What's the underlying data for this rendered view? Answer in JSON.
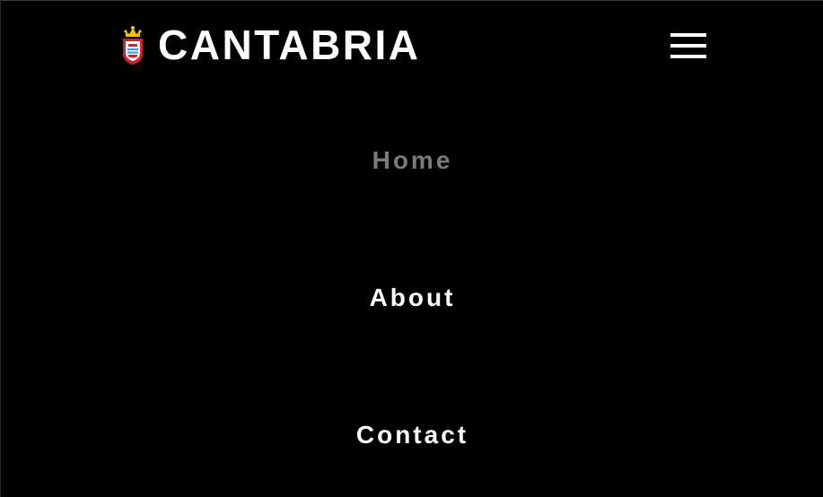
{
  "header": {
    "brand_name": "CANTABRIA",
    "logo_icon": "cantabria-crest-icon",
    "menu_icon": "hamburger-menu-icon"
  },
  "nav": {
    "items": [
      {
        "label": "Home",
        "active": true
      },
      {
        "label": "About",
        "active": false
      },
      {
        "label": "Contact",
        "active": false
      }
    ]
  },
  "colors": {
    "background": "#000000",
    "text": "#ffffff",
    "active_text": "#7a7a7a",
    "crest_red": "#d4202a",
    "crest_gold": "#f2c500",
    "crest_blue": "#3aa0e0"
  }
}
